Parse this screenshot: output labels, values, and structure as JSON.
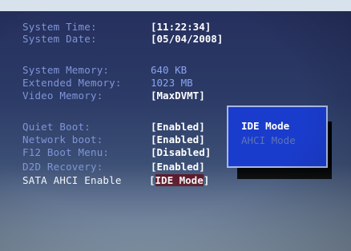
{
  "bios": {
    "system_time_label": "System Time:",
    "system_time_value": "[11:22:34]",
    "system_date_label": "System Date:",
    "system_date_value": "[05/04/2008]",
    "system_memory_label": "System Memory:",
    "system_memory_value": "640 KB",
    "extended_memory_label": "Extended Memory:",
    "extended_memory_value": "1023 MB",
    "video_memory_label": "Video Memory:",
    "video_memory_value": "[MaxDVMT]",
    "quiet_boot_label": "Quiet Boot:",
    "quiet_boot_value": "[Enabled]",
    "network_boot_label": "Network boot:",
    "network_boot_value": "[Enabled]",
    "f12_boot_menu_label": "F12 Boot Menu:",
    "f12_boot_menu_value": "[Disabled]",
    "d2d_recovery_label": "D2D Recovery:",
    "d2d_recovery_value": "[Enabled]",
    "sata_ahci_label": "SATA AHCI Enable",
    "sata_ahci_open": "[",
    "sata_ahci_value": "IDE Mode",
    "sata_ahci_close": "]"
  },
  "popup": {
    "options": [
      "IDE Mode",
      "AHCI Mode"
    ],
    "selected": "IDE Mode"
  },
  "colors": {
    "background": "#26305e",
    "label": "#7f96d8",
    "value": "#ffffff",
    "highlight": "#5a0e1e",
    "popup": "#1a3ccc"
  }
}
